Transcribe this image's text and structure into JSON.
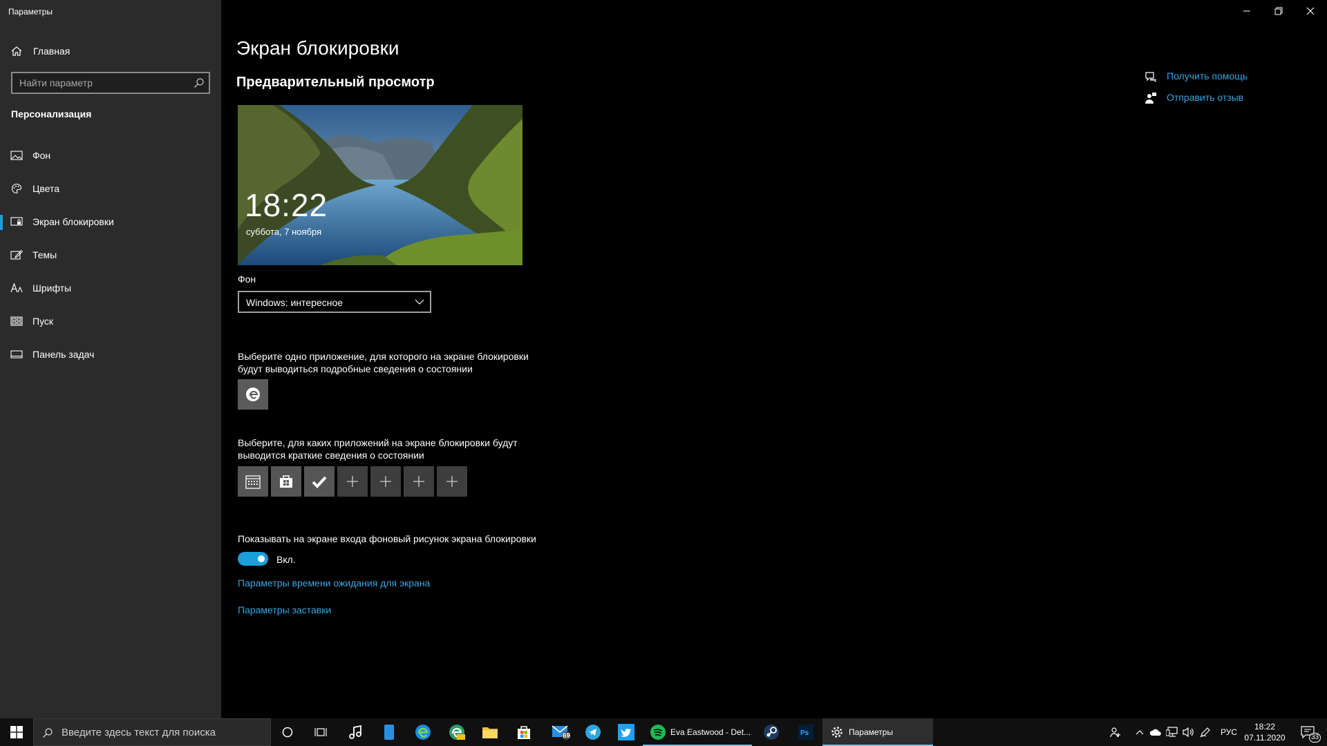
{
  "window": {
    "title": "Параметры",
    "controls": {
      "minimize": "minimize-icon",
      "restore": "restore-icon",
      "close": "close-icon"
    }
  },
  "sidebar": {
    "home_label": "Главная",
    "search_placeholder": "Найти параметр",
    "section": "Персонализация",
    "items": [
      {
        "label": "Фон",
        "icon": "picture-icon"
      },
      {
        "label": "Цвета",
        "icon": "palette-icon"
      },
      {
        "label": "Экран блокировки",
        "icon": "lock-screen-icon",
        "active": true
      },
      {
        "label": "Темы",
        "icon": "brush-icon"
      },
      {
        "label": "Шрифты",
        "icon": "font-icon"
      },
      {
        "label": "Пуск",
        "icon": "start-icon"
      },
      {
        "label": "Панель задач",
        "icon": "taskbar-icon"
      }
    ]
  },
  "main": {
    "title": "Экран блокировки",
    "preview_heading": "Предварительный просмотр",
    "preview": {
      "time": "18:22",
      "date": "суббота, 7 ноября"
    },
    "background_label": "Фон",
    "background_value": "Windows: интересное",
    "detailed_status_text": "Выберите одно приложение, для которого на экране блокировки будут выводиться подробные сведения о состоянии",
    "quick_status_text": "Выберите, для каких приложений на экране блокировки будут выводится краткие сведения о состоянии",
    "quick_status_apps": [
      "calendar-icon",
      "store-icon",
      "check-icon",
      "plus-icon",
      "plus-icon",
      "plus-icon",
      "plus-icon"
    ],
    "show_bg_text": "Показывать на экране входа фоновый рисунок экрана блокировки",
    "toggle_state": "Вкл.",
    "link_timeout": "Параметры времени ожидания для экрана",
    "link_screensaver": "Параметры заставки"
  },
  "help": {
    "get_help": "Получить помощь",
    "feedback": "Отправить отзыв"
  },
  "taskbar": {
    "search_text": "Введите здесь текст для поиска",
    "mail_badge": "69",
    "spotify_label": "Eva Eastwood - Det...",
    "settings_label": "Параметры",
    "language": "РУС",
    "time": "18:22",
    "date": "07.11.2020",
    "notifications": "33",
    "accent": "#1a9fd9"
  }
}
